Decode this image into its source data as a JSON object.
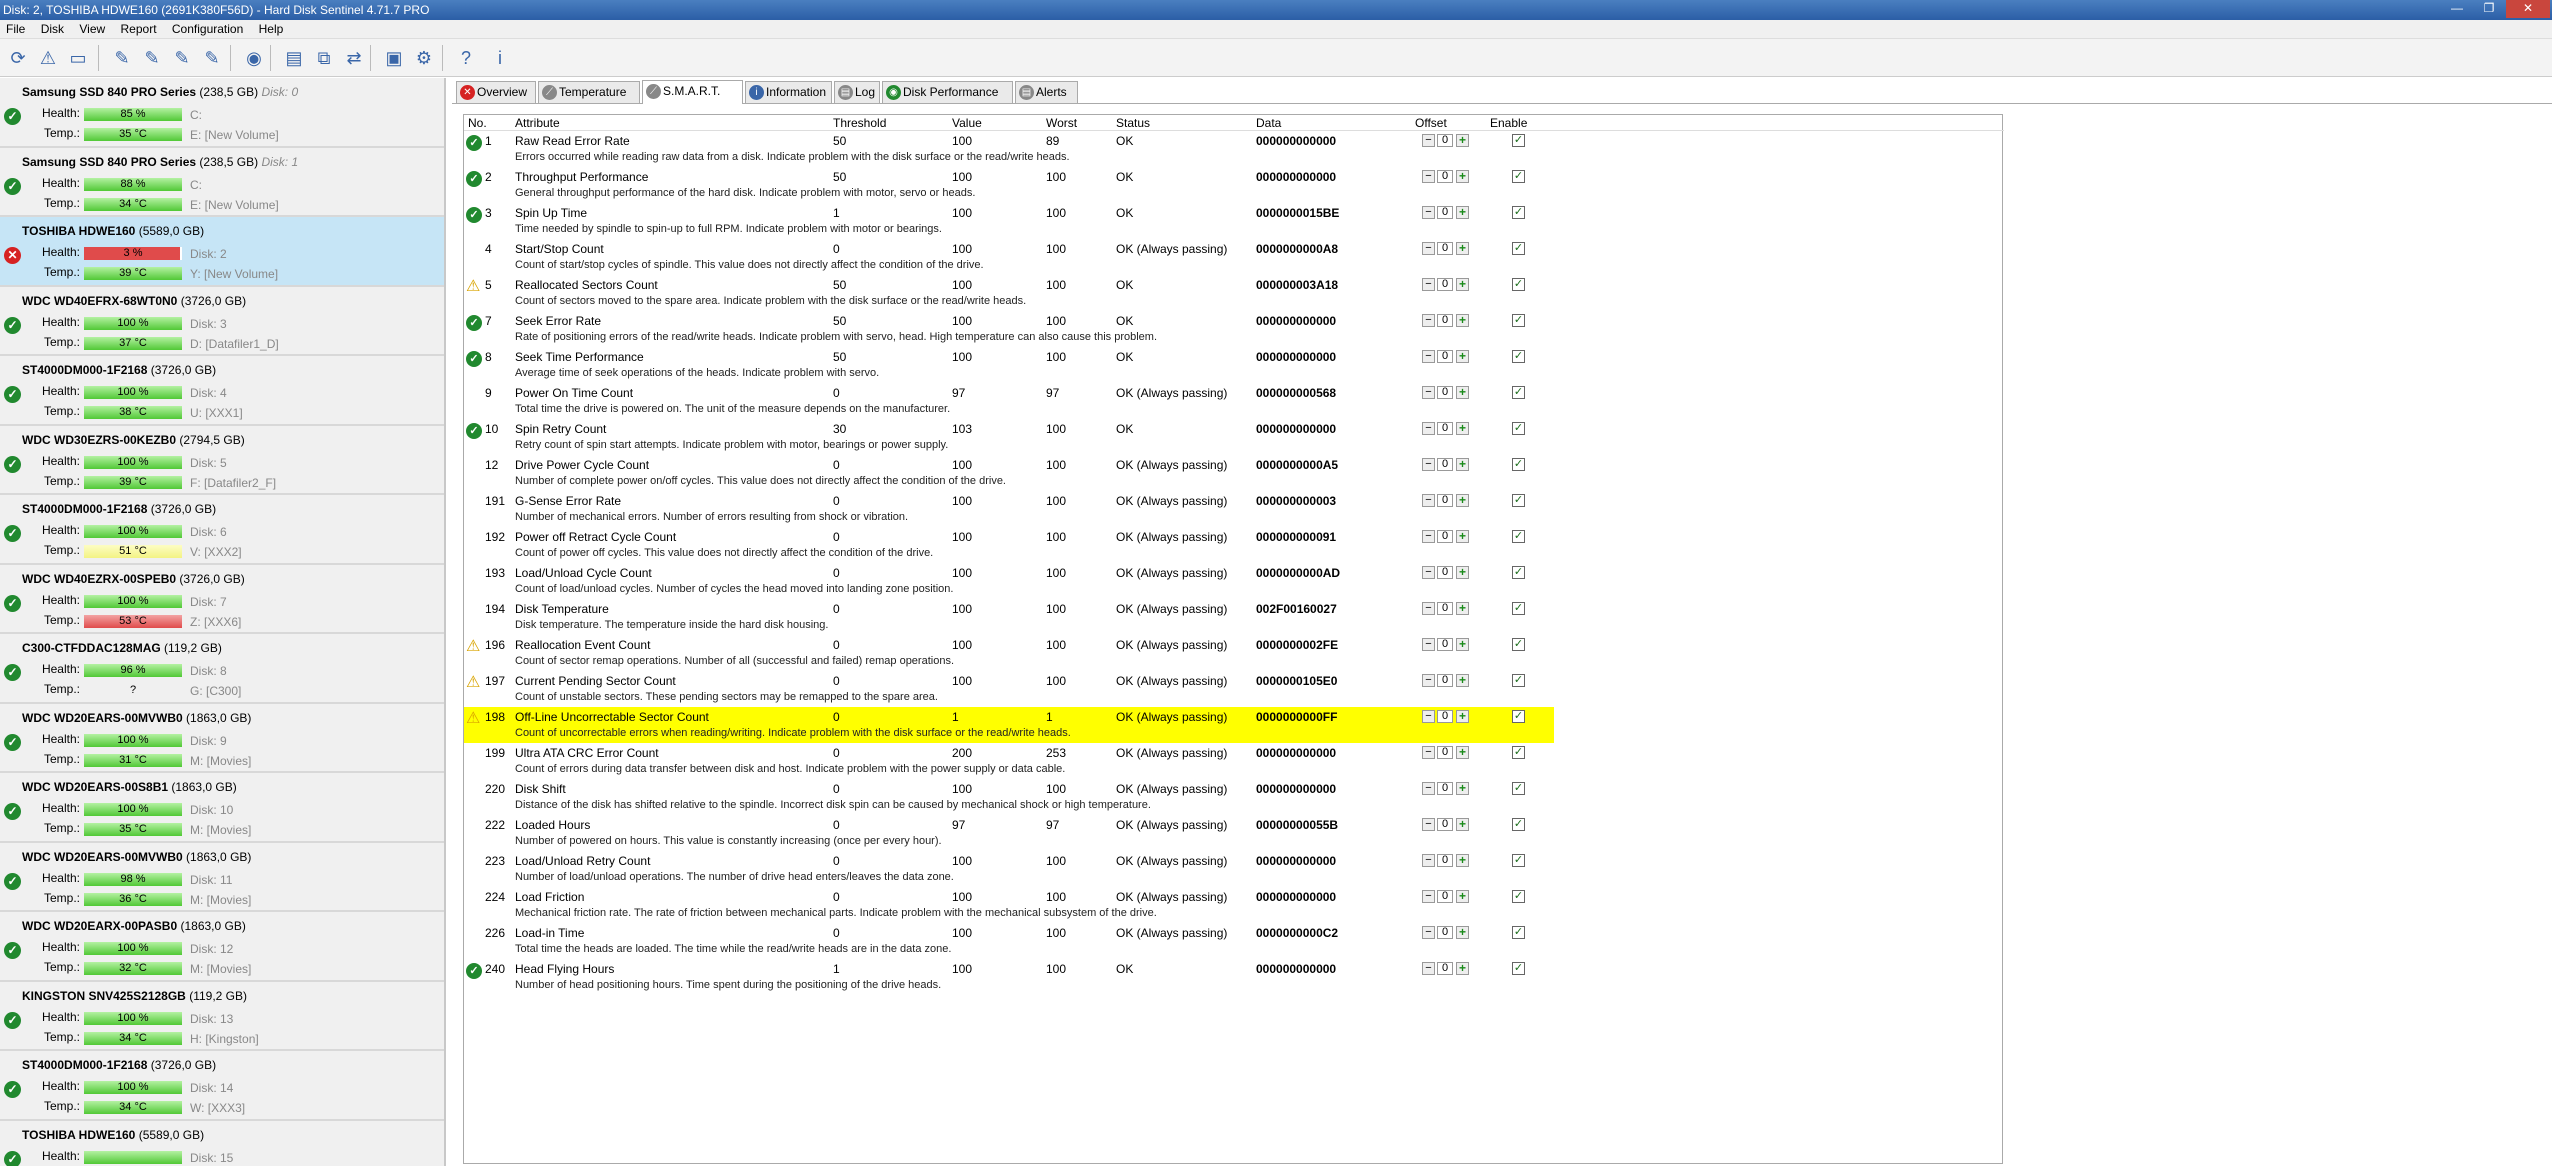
{
  "window": {
    "title": "Disk: 2, TOSHIBA HDWE160 (2691K380F56D)  -  Hard Disk Sentinel 4.71.7 PRO",
    "min": "—",
    "max": "❐",
    "close": "✕"
  },
  "menu": [
    "File",
    "Disk",
    "View",
    "Report",
    "Configuration",
    "Help"
  ],
  "toolbar": [
    {
      "icon": "refresh-icon",
      "glyph": "⟳"
    },
    {
      "icon": "warning-icon",
      "glyph": "⚠"
    },
    {
      "icon": "disk-icon",
      "glyph": "▭"
    },
    {
      "icon": "test-icon",
      "glyph": "✎"
    },
    {
      "icon": "test2-icon",
      "glyph": "✎"
    },
    {
      "icon": "test3-icon",
      "glyph": "✎"
    },
    {
      "icon": "test4-icon",
      "glyph": "✎"
    },
    {
      "icon": "globe-icon",
      "glyph": "◉"
    },
    {
      "icon": "report-icon",
      "glyph": "▤"
    },
    {
      "icon": "copy-icon",
      "glyph": "⧉"
    },
    {
      "icon": "network-icon",
      "glyph": "⇄"
    },
    {
      "icon": "monitor-icon",
      "glyph": "▣"
    },
    {
      "icon": "settings-icon",
      "glyph": "⚙"
    },
    {
      "icon": "help-icon",
      "glyph": "?"
    },
    {
      "icon": "info-icon",
      "glyph": "i"
    }
  ],
  "colors": {
    "ok": "#21892f",
    "bad": "#d62222",
    "highlight": "#ffff00",
    "accent": "#c6e5f6"
  },
  "sidebar": {
    "labels": {
      "health": "Health:",
      "temp": "Temp.:"
    },
    "disks": [
      {
        "name": "Samsung SSD 840 PRO Series",
        "size": "(238,5 GB)",
        "num": "Disk: 0",
        "status": "ok",
        "health": "85 %",
        "health_pct": 85,
        "health_color": "green",
        "drive_h": "C:",
        "temp": "35 °C",
        "temp_color": "green",
        "drive_t": "E: [New Volume]"
      },
      {
        "name": "Samsung SSD 840 PRO Series",
        "size": "(238,5 GB)",
        "num": "Disk: 1",
        "status": "ok",
        "health": "88 %",
        "health_pct": 88,
        "health_color": "green",
        "drive_h": "C:",
        "temp": "34 °C",
        "temp_color": "green",
        "drive_t": "E: [New Volume]"
      },
      {
        "name": "TOSHIBA HDWE160",
        "size": "(5589,0 GB)",
        "num": "",
        "status": "bad",
        "health": "3 %",
        "health_pct": 3,
        "health_color": "red",
        "drive_h": "Disk: 2",
        "temp": "39 °C",
        "temp_color": "green",
        "drive_t": "Y: [New Volume]",
        "selected": true
      },
      {
        "name": "WDC WD40EFRX-68WT0N0",
        "size": "(3726,0 GB)",
        "num": "",
        "status": "ok",
        "health": "100 %",
        "health_pct": 100,
        "health_color": "green",
        "drive_h": "Disk: 3",
        "temp": "37 °C",
        "temp_color": "green",
        "drive_t": "D: [Datafiler1_D]"
      },
      {
        "name": "ST4000DM000-1F2168",
        "size": "(3726,0 GB)",
        "num": "",
        "status": "ok",
        "health": "100 %",
        "health_pct": 100,
        "health_color": "green",
        "drive_h": "Disk: 4",
        "temp": "38 °C",
        "temp_color": "green",
        "drive_t": "U: [XXX1]"
      },
      {
        "name": "WDC WD30EZRS-00KEZB0",
        "size": "(2794,5 GB)",
        "num": "",
        "status": "ok",
        "health": "100 %",
        "health_pct": 100,
        "health_color": "green",
        "drive_h": "Disk: 5",
        "temp": "39 °C",
        "temp_color": "green",
        "drive_t": "F: [Datafiler2_F]"
      },
      {
        "name": "ST4000DM000-1F2168",
        "size": "(3726,0 GB)",
        "num": "",
        "status": "ok",
        "health": "100 %",
        "health_pct": 100,
        "health_color": "green",
        "drive_h": "Disk: 6",
        "temp": "51 °C",
        "temp_color": "yellow",
        "drive_t": "V: [XXX2]"
      },
      {
        "name": "WDC WD40EZRX-00SPEB0",
        "size": "(3726,0 GB)",
        "num": "",
        "status": "ok",
        "health": "100 %",
        "health_pct": 100,
        "health_color": "green",
        "drive_h": "Disk: 7",
        "temp": "53 °C",
        "temp_color": "red",
        "drive_t": "Z: [XXX6]"
      },
      {
        "name": "C300-CTFDDAC128MAG",
        "size": "(119,2 GB)",
        "num": "",
        "status": "ok",
        "health": "96 %",
        "health_pct": 96,
        "health_color": "green",
        "drive_h": "Disk: 8",
        "temp": "?",
        "temp_color": "none",
        "drive_t": "G: [C300]"
      },
      {
        "name": "WDC WD20EARS-00MVWB0",
        "size": "(1863,0 GB)",
        "num": "",
        "status": "ok",
        "health": "100 %",
        "health_pct": 100,
        "health_color": "green",
        "drive_h": "Disk: 9",
        "temp": "31 °C",
        "temp_color": "green",
        "drive_t": "M: [Movies]"
      },
      {
        "name": "WDC WD20EARS-00S8B1",
        "size": "(1863,0 GB)",
        "num": "",
        "status": "ok",
        "health": "100 %",
        "health_pct": 100,
        "health_color": "green",
        "drive_h": "Disk: 10",
        "temp": "35 °C",
        "temp_color": "green",
        "drive_t": "M: [Movies]"
      },
      {
        "name": "WDC WD20EARS-00MVWB0",
        "size": "(1863,0 GB)",
        "num": "",
        "status": "ok",
        "health": "98 %",
        "health_pct": 98,
        "health_color": "green",
        "drive_h": "Disk: 11",
        "temp": "36 °C",
        "temp_color": "green",
        "drive_t": "M: [Movies]"
      },
      {
        "name": "WDC WD20EARX-00PASB0",
        "size": "(1863,0 GB)",
        "num": "",
        "status": "ok",
        "health": "100 %",
        "health_pct": 100,
        "health_color": "green",
        "drive_h": "Disk: 12",
        "temp": "32 °C",
        "temp_color": "green",
        "drive_t": "M: [Movies]"
      },
      {
        "name": "KINGSTON SNV425S2128GB",
        "size": "(119,2 GB)",
        "num": "",
        "status": "ok",
        "health": "100 %",
        "health_pct": 100,
        "health_color": "green",
        "drive_h": "Disk: 13",
        "temp": "34 °C",
        "temp_color": "green",
        "drive_t": "H: [Kingston]"
      },
      {
        "name": "ST4000DM000-1F2168",
        "size": "(3726,0 GB)",
        "num": "",
        "status": "ok",
        "health": "100 %",
        "health_pct": 100,
        "health_color": "green",
        "drive_h": "Disk: 14",
        "temp": "34 °C",
        "temp_color": "green",
        "drive_t": "W: [XXX3]"
      },
      {
        "name": "TOSHIBA HDWE160",
        "size": "(5589,0 GB)",
        "num": "",
        "status": "ok",
        "health": "",
        "health_pct": 100,
        "health_color": "green",
        "drive_h": "Disk: 15",
        "temp": "",
        "temp_color": "none",
        "drive_t": ""
      }
    ]
  },
  "tabs": [
    {
      "label": "Overview",
      "icon": "close-circle-icon",
      "glyph": "✕",
      "color": "#d62222"
    },
    {
      "label": "Temperature",
      "icon": "thermometer-icon",
      "glyph": "⟋",
      "color": "#888"
    },
    {
      "label": "S.M.A.R.T.",
      "icon": "smart-icon",
      "glyph": "⟋",
      "color": "#888",
      "active": true
    },
    {
      "label": "Information",
      "icon": "info-icon",
      "glyph": "i",
      "color": "#3a66a8"
    },
    {
      "label": "Log",
      "icon": "log-icon",
      "glyph": "▤",
      "color": "#888"
    },
    {
      "label": "Disk Performance",
      "icon": "performance-icon",
      "glyph": "◉",
      "color": "#21892f"
    },
    {
      "label": "Alerts",
      "icon": "alerts-icon",
      "glyph": "▤",
      "color": "#888"
    }
  ],
  "smart": {
    "headers": {
      "no": "No.",
      "attribute": "Attribute",
      "threshold": "Threshold",
      "value": "Value",
      "worst": "Worst",
      "status": "Status",
      "data": "Data",
      "offset": "Offset",
      "enable": "Enable"
    },
    "rows": [
      {
        "icon": "ok",
        "no": "1",
        "attr": "Raw Read Error Rate",
        "thr": "50",
        "val": "100",
        "worst": "89",
        "status": "OK",
        "data": "000000000000",
        "desc": "Errors occurred while reading raw data from a disk. Indicate problem with the disk surface or the read/write heads."
      },
      {
        "icon": "ok",
        "no": "2",
        "attr": "Throughput Performance",
        "thr": "50",
        "val": "100",
        "worst": "100",
        "status": "OK",
        "data": "000000000000",
        "desc": "General throughput performance of the hard disk. Indicate problem with motor, servo or heads."
      },
      {
        "icon": "ok",
        "no": "3",
        "attr": "Spin Up Time",
        "thr": "1",
        "val": "100",
        "worst": "100",
        "status": "OK",
        "data": "0000000015BE",
        "desc": "Time needed by spindle to spin-up to full RPM. Indicate problem with motor or bearings."
      },
      {
        "icon": "",
        "no": "4",
        "attr": "Start/Stop Count",
        "thr": "0",
        "val": "100",
        "worst": "100",
        "status": "OK (Always passing)",
        "data": "0000000000A8",
        "desc": "Count of start/stop cycles of spindle. This value does not directly affect the condition of the drive."
      },
      {
        "icon": "warn",
        "no": "5",
        "attr": "Reallocated Sectors Count",
        "thr": "50",
        "val": "100",
        "worst": "100",
        "status": "OK",
        "data": "000000003A18",
        "desc": "Count of sectors moved to the spare area. Indicate problem with the disk surface or the read/write heads."
      },
      {
        "icon": "ok",
        "no": "7",
        "attr": "Seek Error Rate",
        "thr": "50",
        "val": "100",
        "worst": "100",
        "status": "OK",
        "data": "000000000000",
        "desc": "Rate of positioning errors of the read/write heads. Indicate problem with servo, head. High temperature can also cause this problem."
      },
      {
        "icon": "ok",
        "no": "8",
        "attr": "Seek Time Performance",
        "thr": "50",
        "val": "100",
        "worst": "100",
        "status": "OK",
        "data": "000000000000",
        "desc": "Average time of seek operations of the heads. Indicate problem with servo."
      },
      {
        "icon": "",
        "no": "9",
        "attr": "Power On Time Count",
        "thr": "0",
        "val": "97",
        "worst": "97",
        "status": "OK (Always passing)",
        "data": "000000000568",
        "desc": "Total time the drive is powered on. The unit of the measure depends on the manufacturer."
      },
      {
        "icon": "ok",
        "no": "10",
        "attr": "Spin Retry Count",
        "thr": "30",
        "val": "103",
        "worst": "100",
        "status": "OK",
        "data": "000000000000",
        "desc": "Retry count of spin start attempts. Indicate problem with motor, bearings or power supply."
      },
      {
        "icon": "",
        "no": "12",
        "attr": "Drive Power Cycle Count",
        "thr": "0",
        "val": "100",
        "worst": "100",
        "status": "OK (Always passing)",
        "data": "0000000000A5",
        "desc": "Number of complete power on/off cycles. This value does not directly affect the condition of the drive."
      },
      {
        "icon": "",
        "no": "191",
        "attr": "G-Sense Error Rate",
        "thr": "0",
        "val": "100",
        "worst": "100",
        "status": "OK (Always passing)",
        "data": "000000000003",
        "desc": "Number of mechanical errors. Number of errors resulting from shock or vibration."
      },
      {
        "icon": "",
        "no": "192",
        "attr": "Power off Retract Cycle Count",
        "thr": "0",
        "val": "100",
        "worst": "100",
        "status": "OK (Always passing)",
        "data": "000000000091",
        "desc": "Count of power off cycles. This value does not directly affect the condition of the drive."
      },
      {
        "icon": "",
        "no": "193",
        "attr": "Load/Unload Cycle Count",
        "thr": "0",
        "val": "100",
        "worst": "100",
        "status": "OK (Always passing)",
        "data": "0000000000AD",
        "desc": "Count of load/unload cycles. Number of cycles the head moved into landing zone position."
      },
      {
        "icon": "",
        "no": "194",
        "attr": "Disk Temperature",
        "thr": "0",
        "val": "100",
        "worst": "100",
        "status": "OK (Always passing)",
        "data": "002F00160027",
        "desc": "Disk temperature. The temperature inside the hard disk housing."
      },
      {
        "icon": "warn",
        "no": "196",
        "attr": "Reallocation Event Count",
        "thr": "0",
        "val": "100",
        "worst": "100",
        "status": "OK (Always passing)",
        "data": "0000000002FE",
        "desc": "Count of sector remap operations. Number of all (successful and failed) remap operations."
      },
      {
        "icon": "warn",
        "no": "197",
        "attr": "Current Pending Sector Count",
        "thr": "0",
        "val": "100",
        "worst": "100",
        "status": "OK (Always passing)",
        "data": "0000000105E0",
        "desc": "Count of unstable sectors. These pending sectors may be remapped to the spare area."
      },
      {
        "icon": "warn",
        "no": "198",
        "attr": "Off-Line Uncorrectable Sector Count",
        "thr": "0",
        "val": "1",
        "worst": "1",
        "status": "OK (Always passing)",
        "data": "0000000000FF",
        "desc": "Count of uncorrectable errors when reading/writing. Indicate problem with the disk surface or the read/write heads.",
        "highlight": true
      },
      {
        "icon": "",
        "no": "199",
        "attr": "Ultra ATA CRC Error Count",
        "thr": "0",
        "val": "200",
        "worst": "253",
        "status": "OK (Always passing)",
        "data": "000000000000",
        "desc": "Count of errors during data transfer between disk and host. Indicate problem with the power supply or data cable."
      },
      {
        "icon": "",
        "no": "220",
        "attr": "Disk Shift",
        "thr": "0",
        "val": "100",
        "worst": "100",
        "status": "OK (Always passing)",
        "data": "000000000000",
        "desc": "Distance of the disk has shifted relative to the spindle. Incorrect disk spin can be caused by mechanical shock or high temperature."
      },
      {
        "icon": "",
        "no": "222",
        "attr": "Loaded Hours",
        "thr": "0",
        "val": "97",
        "worst": "97",
        "status": "OK (Always passing)",
        "data": "00000000055B",
        "desc": "Number of powered on hours. This value is constantly increasing (once per every hour)."
      },
      {
        "icon": "",
        "no": "223",
        "attr": "Load/Unload Retry Count",
        "thr": "0",
        "val": "100",
        "worst": "100",
        "status": "OK (Always passing)",
        "data": "000000000000",
        "desc": "Number of load/unload operations. The number of drive head enters/leaves the data zone."
      },
      {
        "icon": "",
        "no": "224",
        "attr": "Load Friction",
        "thr": "0",
        "val": "100",
        "worst": "100",
        "status": "OK (Always passing)",
        "data": "000000000000",
        "desc": "Mechanical friction rate. The rate of friction between mechanical parts. Indicate problem with the mechanical subsystem of the drive."
      },
      {
        "icon": "",
        "no": "226",
        "attr": "Load-in Time",
        "thr": "0",
        "val": "100",
        "worst": "100",
        "status": "OK (Always passing)",
        "data": "0000000000C2",
        "desc": "Total time the heads are loaded. The time while the read/write heads are in the data zone."
      },
      {
        "icon": "ok",
        "no": "240",
        "attr": "Head Flying Hours",
        "thr": "1",
        "val": "100",
        "worst": "100",
        "status": "OK",
        "data": "000000000000",
        "desc": "Number of head positioning hours. Time spent during the positioning of the drive heads."
      }
    ],
    "offset_value": "0",
    "offset_minus": "−",
    "offset_plus": "+",
    "check_mark": "✓"
  }
}
